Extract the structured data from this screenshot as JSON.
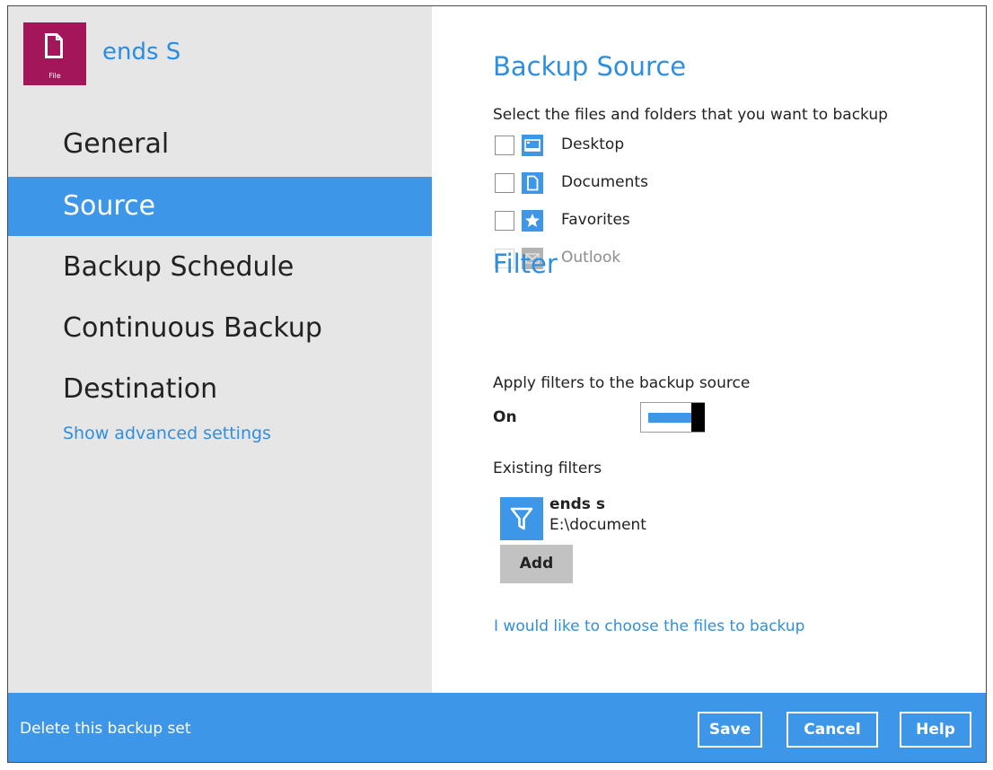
{
  "app": {
    "name": "ends S",
    "icon_caption": "File",
    "icon": "file-icon"
  },
  "sidebar": {
    "items": [
      {
        "label": "General",
        "active": false
      },
      {
        "label": "Source",
        "active": true
      },
      {
        "label": "Backup Schedule",
        "active": false
      },
      {
        "label": "Continuous Backup",
        "active": false
      },
      {
        "label": "Destination",
        "active": false
      }
    ],
    "advanced_link": "Show advanced settings"
  },
  "source": {
    "heading": "Backup Source",
    "instruction": "Select the files and folders that you want to backup",
    "items": [
      {
        "label": "Desktop",
        "icon": "desktop-icon",
        "checked": false,
        "enabled": true
      },
      {
        "label": "Documents",
        "icon": "document-icon",
        "checked": false,
        "enabled": true
      },
      {
        "label": "Favorites",
        "icon": "star-icon",
        "checked": false,
        "enabled": true
      },
      {
        "label": "Outlook",
        "icon": "mail-icon",
        "checked": false,
        "enabled": false
      }
    ]
  },
  "filter": {
    "heading": "Filter",
    "apply_label": "Apply filters to the backup source",
    "state_label": "On",
    "toggle_on": true,
    "existing_label": "Existing filters",
    "filters": [
      {
        "name": "ends s",
        "path": "E:\\document",
        "icon": "filter-icon"
      }
    ],
    "add_label": "Add",
    "choose_link": "I would like to choose the files to backup"
  },
  "footer": {
    "delete_label": "Delete this backup set",
    "save_label": "Save",
    "cancel_label": "Cancel",
    "help_label": "Help"
  },
  "colors": {
    "accent": "#3d96e8",
    "link": "#2f8fdf",
    "sidebar_bg": "#e6e6e6",
    "app_icon_bg": "#a3175a",
    "add_button_bg": "#c2c2c2"
  }
}
